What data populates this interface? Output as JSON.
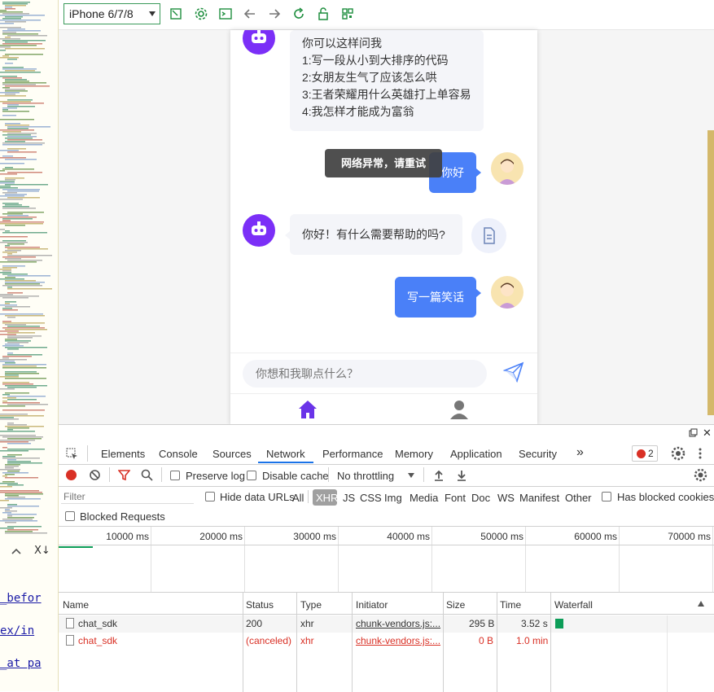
{
  "left_pane": {
    "nav_up": "^",
    "nav_close": "X↓",
    "links": [
      "_befor",
      "ex/in",
      "_at pa"
    ]
  },
  "toolbar": {
    "device": "iPhone 6/7/8"
  },
  "chat": {
    "bot_intro": {
      "lines": [
        "你可以这样问我",
        "1:写一段从小到大排序的代码",
        "2:女朋友生气了应该怎么哄",
        "3:王者荣耀用什么英雄打上单容易",
        "4:我怎样才能成为富翁"
      ]
    },
    "toast": "网络异常，请重试",
    "user_msg_1": "你好",
    "bot_reply": "你好！有什么需要帮助的吗?",
    "user_msg_2": "写一篇笑话",
    "input_placeholder": "你想和我聊点什么？"
  },
  "devtools": {
    "tabs": [
      "Elements",
      "Console",
      "Sources",
      "Network",
      "Performance",
      "Memory",
      "Application",
      "Security",
      "»"
    ],
    "active_tab": "Network",
    "error_count": "2",
    "toolbar": {
      "preserve_log": "Preserve log",
      "disable_cache": "Disable cache",
      "throttling": "No throttling"
    },
    "filter": {
      "placeholder": "Filter",
      "hide_data_urls": "Hide data URLs",
      "types": [
        "All",
        "XHR",
        "JS",
        "CSS",
        "Img",
        "Media",
        "Font",
        "Doc",
        "WS",
        "Manifest",
        "Other"
      ],
      "active_type": "XHR",
      "has_blocked_cookies": "Has blocked cookies",
      "blocked_requests": "Blocked Requests"
    },
    "timeline_ticks": [
      "10000 ms",
      "20000 ms",
      "30000 ms",
      "40000 ms",
      "50000 ms",
      "60000 ms",
      "70000 ms"
    ],
    "columns": [
      "Name",
      "Status",
      "Type",
      "Initiator",
      "Size",
      "Time",
      "Waterfall"
    ],
    "rows": [
      {
        "name": "chat_sdk",
        "status": "200",
        "type": "xhr",
        "initiator": "chunk-vendors.js:...",
        "size": "295 B",
        "time": "3.52 s",
        "error": false
      },
      {
        "name": "chat_sdk",
        "status": "(canceled)",
        "type": "xhr",
        "initiator": "chunk-vendors.js:...",
        "size": "0 B",
        "time": "1.0 min",
        "error": true
      }
    ],
    "colors": {
      "accent": "#1a73e8",
      "error": "#d93025",
      "record": "#d93025",
      "waterfall": "#0c9d58"
    }
  }
}
